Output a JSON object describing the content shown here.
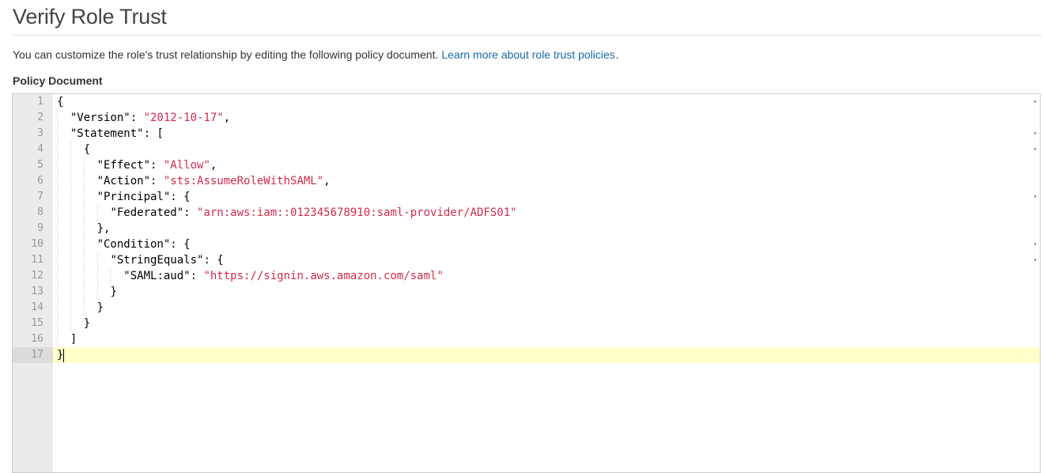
{
  "page": {
    "title": "Verify Role Trust",
    "description": "You can customize the role's trust relationship by editing the following policy document.",
    "learn_more_link": "Learn more about role trust policies",
    "period": ".",
    "policy_label": "Policy Document"
  },
  "editor": {
    "active_line": 17,
    "lines": [
      {
        "n": "1",
        "fold": true,
        "indent": 0,
        "parts": [
          [
            "p",
            "{"
          ]
        ]
      },
      {
        "n": "2",
        "fold": false,
        "indent": 1,
        "parts": [
          [
            "p",
            "\"Version\": "
          ],
          [
            "s",
            "\"2012-10-17\""
          ],
          [
            "p",
            ","
          ]
        ]
      },
      {
        "n": "3",
        "fold": true,
        "indent": 1,
        "parts": [
          [
            "p",
            "\"Statement\": ["
          ]
        ]
      },
      {
        "n": "4",
        "fold": true,
        "indent": 2,
        "parts": [
          [
            "p",
            "{"
          ]
        ]
      },
      {
        "n": "5",
        "fold": false,
        "indent": 3,
        "parts": [
          [
            "p",
            "\"Effect\": "
          ],
          [
            "s",
            "\"Allow\""
          ],
          [
            "p",
            ","
          ]
        ]
      },
      {
        "n": "6",
        "fold": false,
        "indent": 3,
        "parts": [
          [
            "p",
            "\"Action\": "
          ],
          [
            "s",
            "\"sts:AssumeRoleWithSAML\""
          ],
          [
            "p",
            ","
          ]
        ]
      },
      {
        "n": "7",
        "fold": true,
        "indent": 3,
        "parts": [
          [
            "p",
            "\"Principal\": {"
          ]
        ]
      },
      {
        "n": "8",
        "fold": false,
        "indent": 4,
        "parts": [
          [
            "p",
            "\"Federated\": "
          ],
          [
            "s",
            "\"arn:aws:iam::012345678910:saml-provider/ADFS01\""
          ]
        ]
      },
      {
        "n": "9",
        "fold": false,
        "indent": 3,
        "parts": [
          [
            "p",
            "},"
          ]
        ]
      },
      {
        "n": "10",
        "fold": true,
        "indent": 3,
        "parts": [
          [
            "p",
            "\"Condition\": {"
          ]
        ]
      },
      {
        "n": "11",
        "fold": true,
        "indent": 4,
        "parts": [
          [
            "p",
            "\"StringEquals\": {"
          ]
        ]
      },
      {
        "n": "12",
        "fold": false,
        "indent": 5,
        "parts": [
          [
            "p",
            "\"SAML:aud\": "
          ],
          [
            "s",
            "\"https://signin.aws.amazon.com/saml\""
          ]
        ]
      },
      {
        "n": "13",
        "fold": false,
        "indent": 4,
        "parts": [
          [
            "p",
            "}"
          ]
        ]
      },
      {
        "n": "14",
        "fold": false,
        "indent": 3,
        "parts": [
          [
            "p",
            "}"
          ]
        ]
      },
      {
        "n": "15",
        "fold": false,
        "indent": 2,
        "parts": [
          [
            "p",
            "}"
          ]
        ]
      },
      {
        "n": "16",
        "fold": false,
        "indent": 1,
        "parts": [
          [
            "p",
            "]"
          ]
        ]
      },
      {
        "n": "17",
        "fold": false,
        "indent": 0,
        "parts": [
          [
            "p",
            "}"
          ]
        ]
      }
    ]
  },
  "icons": {
    "fold": "fold-arrow-icon"
  }
}
